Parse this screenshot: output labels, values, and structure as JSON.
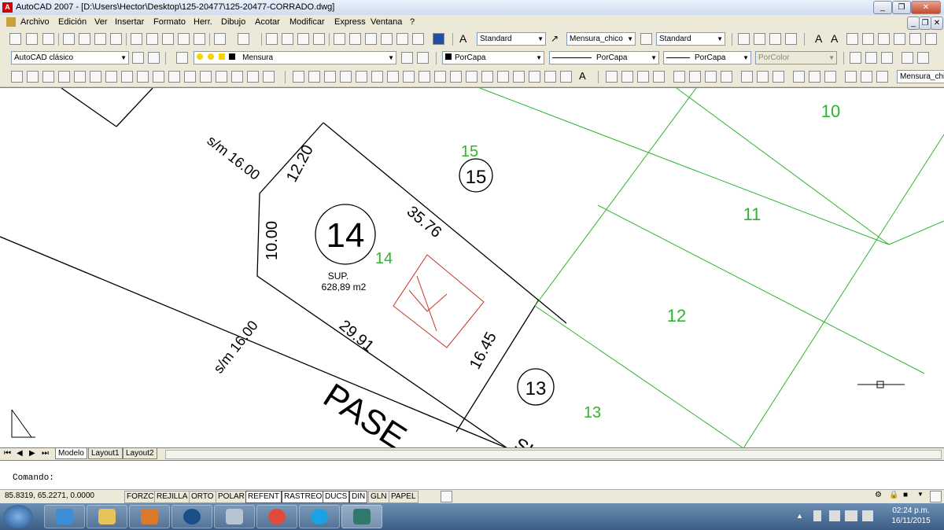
{
  "window": {
    "title": "AutoCAD 2007 - [D:\\Users\\Hector\\Desktop\\125-20477\\125-20477-CORRADO.dwg]",
    "app_icon": "A"
  },
  "menu": [
    "Archivo",
    "Edición",
    "Ver",
    "Insertar",
    "Formato",
    "Herr.",
    "Dibujo",
    "Acotar",
    "Modificar",
    "Express",
    "Ventana",
    "?"
  ],
  "toolbar1": {
    "text_style": "Standard",
    "dim_style": "Mensura_chico",
    "table_style": "Standard"
  },
  "toolbar2": {
    "workspace": "AutoCAD clásico",
    "layer": "Mensura",
    "color": "PorCapa",
    "linetype": "PorCapa",
    "lineweight": "PorCapa",
    "plotstyle": "PorColor"
  },
  "toolbar3": {
    "dim_style_right": "Mensura_chico",
    "text_glyph": "A"
  },
  "drawing": {
    "streets": [
      "s/m 16.00",
      "s/m 16.00"
    ],
    "street_name_partial": "PASE",
    "street_name_partial_2": "SI",
    "lots": [
      {
        "id": "14",
        "big": "14",
        "label": "14"
      },
      {
        "id": "15",
        "big": "15",
        "label": "15"
      },
      {
        "id": "13",
        "big": "13",
        "label": "13"
      },
      {
        "id": "12",
        "label": "12"
      },
      {
        "id": "11",
        "label": "11"
      },
      {
        "id": "10",
        "label": "10"
      }
    ],
    "area_label": "SUP.",
    "area_value": "628,89 m2",
    "dimensions": [
      "12.20",
      "10.00",
      "35.76",
      "29.91",
      "16.45"
    ],
    "colors": {
      "green": "#2db52d",
      "red": "#c0392b",
      "yellow": "#d9c021",
      "black": "#000000"
    }
  },
  "tabs": {
    "model": "Modelo",
    "layout1": "Layout1",
    "layout2": "Layout2"
  },
  "command": {
    "prompt": "Comando:"
  },
  "status": {
    "coords": "85.8319, 65.2271, 0.0000",
    "buttons": [
      "FORZC",
      "REJILLA",
      "ORTO",
      "POLAR",
      "REFENT",
      "RASTREO",
      "DUCS",
      "DIN",
      "GLN",
      "PAPEL"
    ]
  },
  "taskbar": {
    "time": "02:24 p.m.",
    "date": "16/11/2015"
  }
}
